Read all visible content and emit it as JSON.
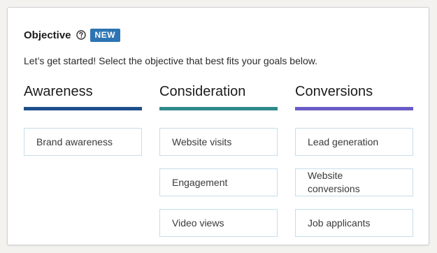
{
  "header": {
    "title": "Objective",
    "badge": "NEW",
    "help_icon": "question-circle-icon"
  },
  "subtitle": "Let’s get started! Select the objective that best fits your goals below.",
  "columns": [
    {
      "title": "Awareness",
      "color": "#1e4f8a",
      "options": [
        "Brand awareness"
      ]
    },
    {
      "title": "Consideration",
      "color": "#2f8a8c",
      "options": [
        "Website visits",
        "Engagement",
        "Video views"
      ]
    },
    {
      "title": "Conversions",
      "color": "#6a5cc7",
      "options": [
        "Lead generation",
        "Website conversions",
        "Job applicants"
      ]
    }
  ]
}
